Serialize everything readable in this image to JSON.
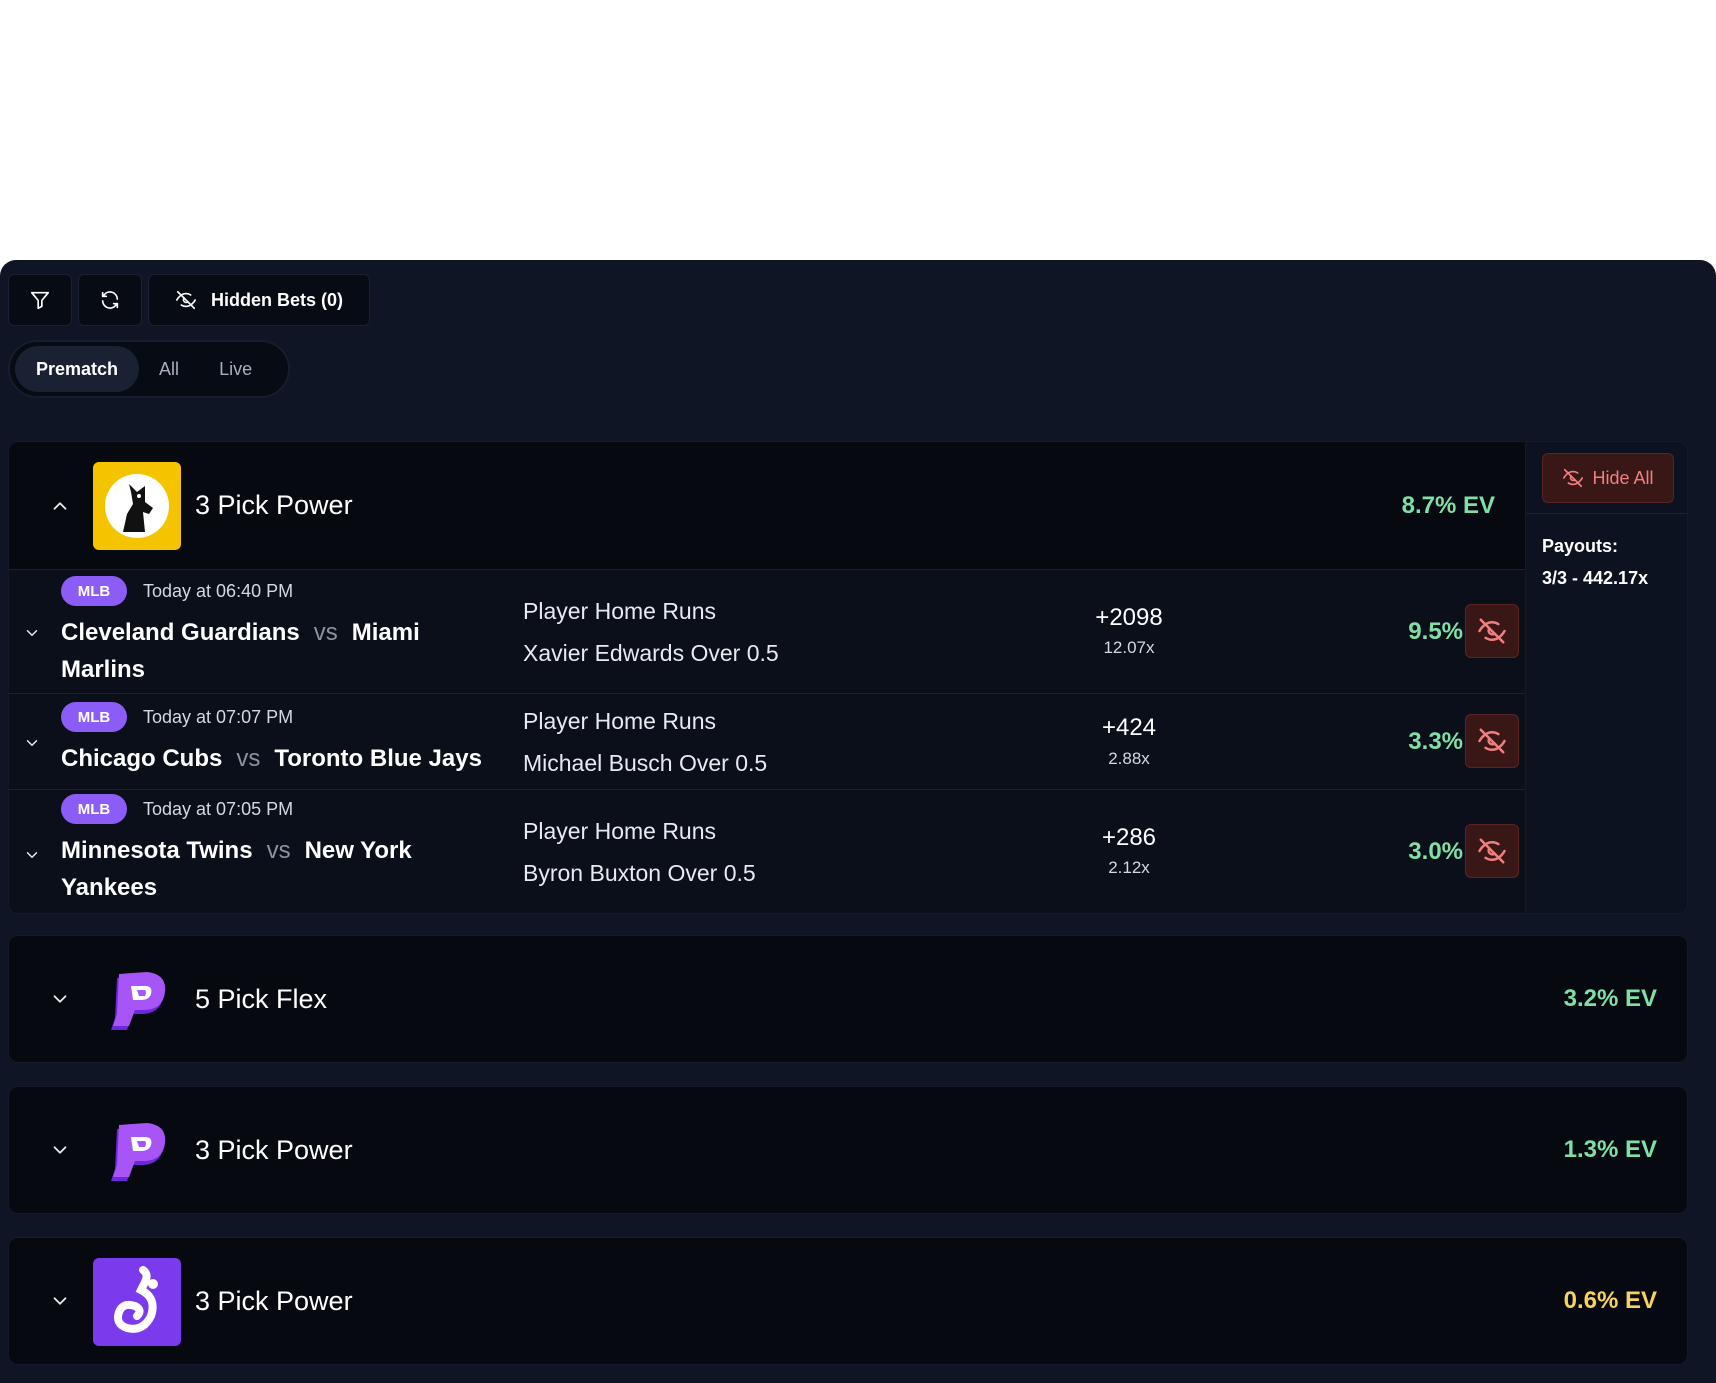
{
  "toolbar": {
    "filter_icon": "filter-icon",
    "refresh_icon": "refresh-icon",
    "hidden_bets_label": "Hidden Bets (0)"
  },
  "tabs": [
    {
      "label": "Prematch",
      "active": true
    },
    {
      "label": "All",
      "active": false
    },
    {
      "label": "Live",
      "active": false
    }
  ],
  "groups": [
    {
      "title": "3 Pick Power",
      "ev": "8.7% EV",
      "ev_color": "#7fe0a6",
      "logo": "underdog-logo",
      "expanded": true,
      "hide_all_label": "Hide All",
      "payouts_label": "Payouts:",
      "payouts_value": "3/3 - 442.17x",
      "rows": [
        {
          "league": "MLB",
          "time": "Today at 06:40 PM",
          "home": "Cleveland Guardians",
          "vs": "vs",
          "away": "Miami Marlins",
          "market": "Player Home Runs",
          "pick": "Xavier Edwards Over 0.5",
          "odds": "+2098",
          "multiplier": "12.07x",
          "ev": "9.5%"
        },
        {
          "league": "MLB",
          "time": "Today at 07:07 PM",
          "home": "Chicago Cubs",
          "vs": "vs",
          "away": "Toronto Blue Jays",
          "market": "Player Home Runs",
          "pick": "Michael Busch Over 0.5",
          "odds": "+424",
          "multiplier": "2.88x",
          "ev": "3.3%"
        },
        {
          "league": "MLB",
          "time": "Today at 07:05 PM",
          "home": "Minnesota Twins",
          "vs": "vs",
          "away": "New York Yankees",
          "market": "Player Home Runs",
          "pick": "Byron Buxton Over 0.5",
          "odds": "+286",
          "multiplier": "2.12x",
          "ev": "3.0%"
        }
      ]
    },
    {
      "title": "5 Pick Flex",
      "ev": "3.2% EV",
      "ev_color": "#7fe0a6",
      "logo": "prizepicks-logo",
      "expanded": false
    },
    {
      "title": "3 Pick Power",
      "ev": "1.3% EV",
      "ev_color": "#7fe0a6",
      "logo": "prizepicks-logo",
      "expanded": false
    },
    {
      "title": "3 Pick Power",
      "ev": "0.6% EV",
      "ev_color": "#f7d35c",
      "logo": "dabble-logo",
      "expanded": false
    }
  ]
}
